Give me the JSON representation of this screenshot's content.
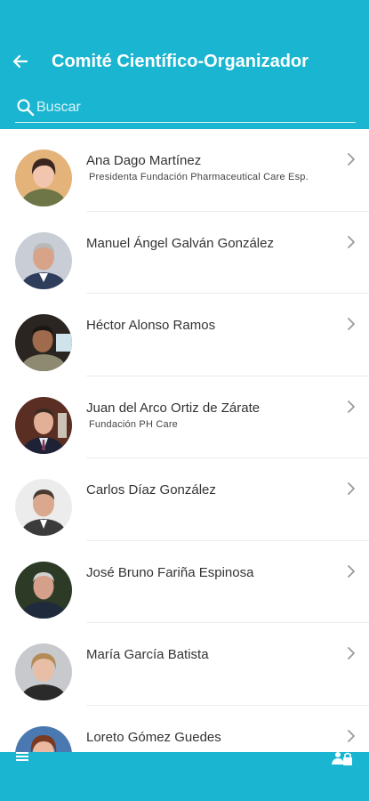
{
  "header": {
    "title": "Comité Científico-Organizador",
    "back_icon": "arrow-left-icon"
  },
  "search": {
    "placeholder": "Buscar",
    "icon": "search-icon"
  },
  "members": [
    {
      "name": "Ana Dago Martínez",
      "subtitle": "Presidenta Fundación Pharmaceutical Care Esp."
    },
    {
      "name": "Manuel Ángel Galván González",
      "subtitle": ""
    },
    {
      "name": "Héctor Alonso Ramos",
      "subtitle": ""
    },
    {
      "name": "Juan del Arco Ortiz de Zárate",
      "subtitle": "Fundación PH Care"
    },
    {
      "name": "Carlos Díaz González",
      "subtitle": ""
    },
    {
      "name": "José Bruno Fariña Espinosa",
      "subtitle": ""
    },
    {
      "name": "María García Batista",
      "subtitle": ""
    },
    {
      "name": "Loreto Gómez Guedes",
      "subtitle": ""
    }
  ],
  "footer": {
    "menu_icon": "hamburger-menu-icon",
    "lock_icon": "user-lock-icon"
  },
  "colors": {
    "accent": "#1ab5d1",
    "text": "#333333",
    "chevron": "#9a9a9a"
  }
}
